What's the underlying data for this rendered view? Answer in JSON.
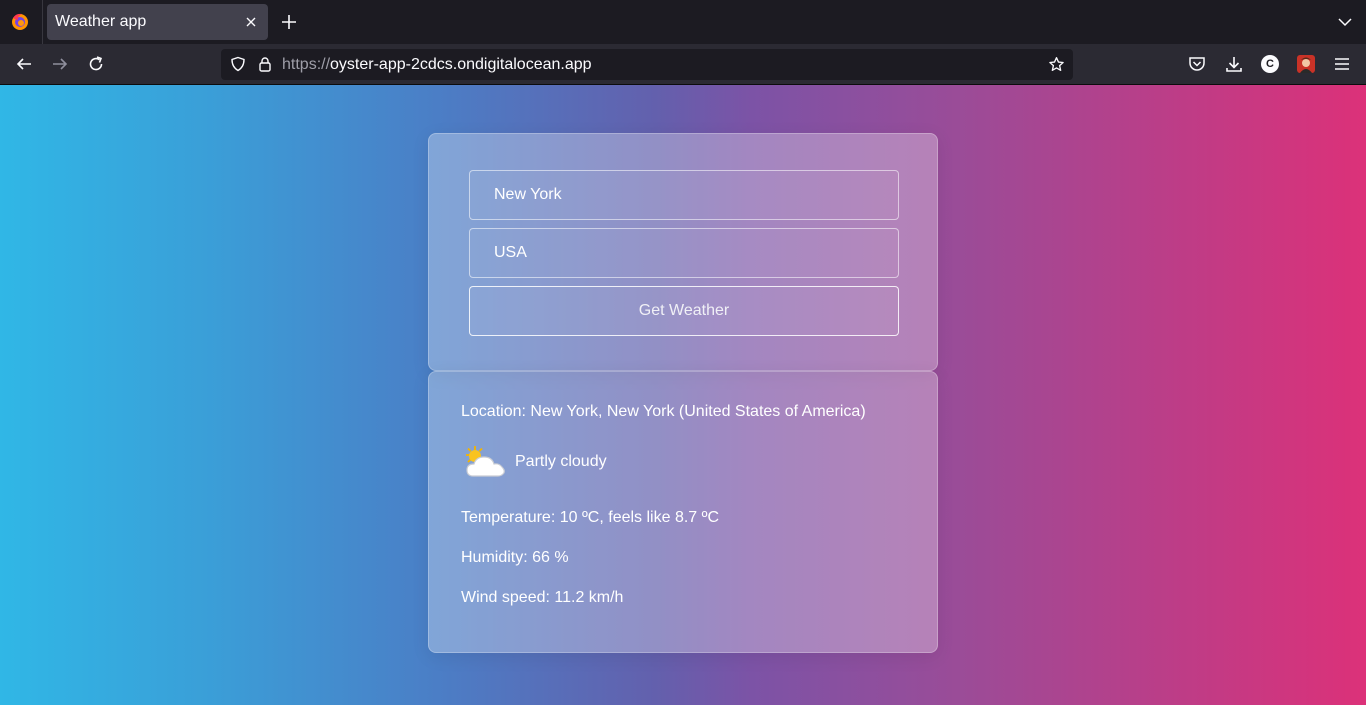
{
  "browser": {
    "tab_title": "Weather app",
    "url_protocol": "https://",
    "url_host": "oyster-app-2cdcs.ondigitalocean.app",
    "profile_initial": "C"
  },
  "form": {
    "city_value": "New York",
    "country_value": "USA",
    "submit_label": "Get Weather"
  },
  "result": {
    "location": "Location: New York, New York (United States of America)",
    "condition": "Partly cloudy",
    "condition_icon": "partly-cloudy-icon",
    "temperature": "Temperature: 10 ºC, feels like 8.7 ºC",
    "humidity": "Humidity: 66 %",
    "wind": "Wind speed: 11.2 km/h"
  },
  "colors": {
    "gradient_left": "#30b7e6",
    "gradient_mid": "#6360ad",
    "gradient_right": "#dc3179",
    "chrome_dark": "#1c1b22",
    "chrome_toolbar": "#2b2a33"
  }
}
